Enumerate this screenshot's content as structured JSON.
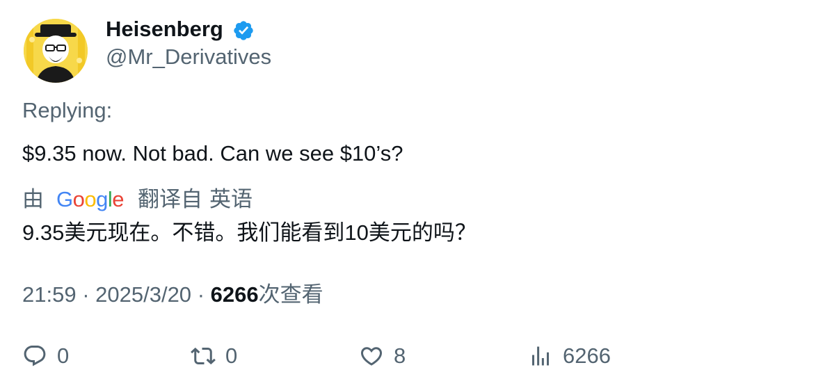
{
  "author": {
    "display_name": "Heisenberg",
    "handle": "@Mr_Derivatives",
    "verified": true,
    "avatar_icon": "heisenberg-avatar",
    "verified_color": "#1d9bf0"
  },
  "replying_label": "Replying:",
  "tweet_text": "$9.35 now. Not bad. Can we see $10’s?",
  "translation": {
    "prefix": "由",
    "provider": "Google",
    "suffix": "翻译自",
    "source_language": "英语",
    "text": "9.35美元现在。不错。我们能看到10美元的吗？"
  },
  "meta": {
    "time": "21:59",
    "separator": "·",
    "date": "2025/3/20",
    "views_count": "6266",
    "views_label": "次查看"
  },
  "actions": {
    "reply": {
      "icon": "reply-icon",
      "count": "0"
    },
    "retweet": {
      "icon": "retweet-icon",
      "count": "0"
    },
    "like": {
      "icon": "heart-icon",
      "count": "8"
    },
    "views": {
      "icon": "analytics-icon",
      "count": "6266"
    }
  },
  "colors": {
    "primary_text": "#0f1419",
    "secondary_text": "#536471",
    "avatar_background": "#f7d84a"
  }
}
